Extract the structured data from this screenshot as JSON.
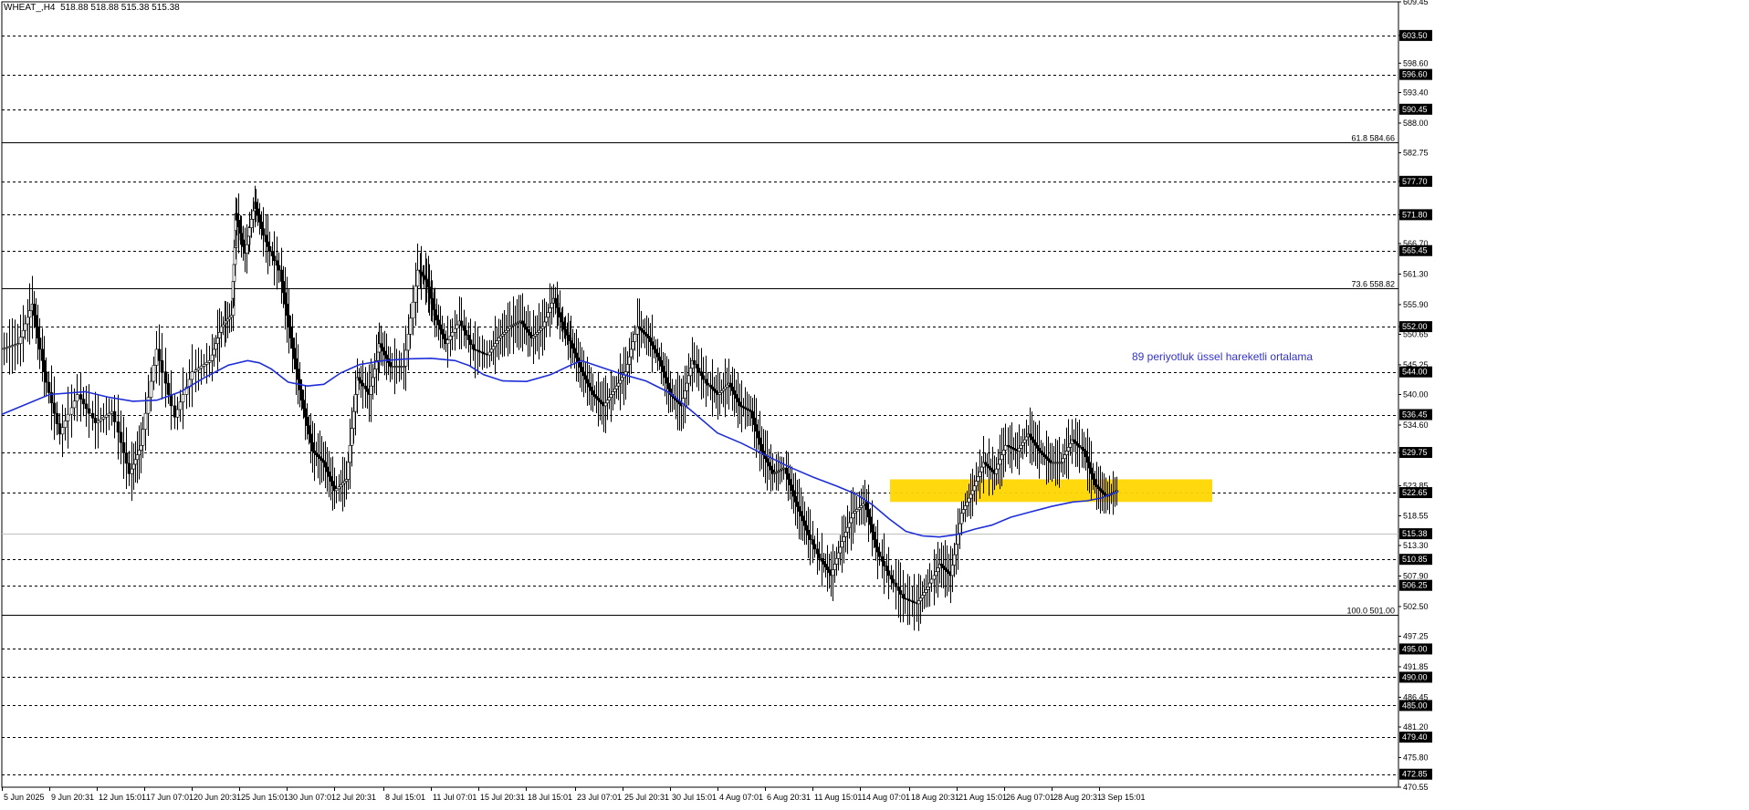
{
  "header": {
    "symbol": "WHEAT_,H4",
    "ohlc": "518.88 518.88 515.38 515.38"
  },
  "chart_data": {
    "type": "line",
    "title": "",
    "xlabel": "",
    "ylabel": "",
    "grid": false,
    "ylim": [
      470.55,
      609.45
    ],
    "y_ticks": [
      "609.45",
      "603.50",
      "598.60",
      "593.40",
      "588.00",
      "582.75",
      "577.70",
      "571.80",
      "566.70",
      "561.30",
      "555.90",
      "552.00",
      "550.65",
      "545.25",
      "540.00",
      "534.60",
      "529.75",
      "523.85",
      "518.55",
      "513.30",
      "507.90",
      "502.50",
      "497.25",
      "491.85",
      "486.45",
      "481.20",
      "475.80",
      "470.55"
    ],
    "x_ticks": [
      "5 Jun 2025",
      "9 Jun 20:31",
      "12 Jun 15:01",
      "17 Jun 07:01",
      "20 Jun 20:31",
      "25 Jun 15:01",
      "30 Jun 07:01",
      "2 Jul 20:31",
      "8 Jul 15:01",
      "11 Jul 07:01",
      "15 Jul 20:31",
      "18 Jul 15:01",
      "23 Jul 07:01",
      "25 Jul 20:31",
      "30 Jul 15:01",
      "4 Aug 07:01",
      "6 Aug 20:31",
      "11 Aug 15:01",
      "14 Aug 07:01",
      "18 Aug 20:31",
      "21 Aug 15:01",
      "26 Aug 07:01",
      "28 Aug 20:31",
      "3 Sep 15:01"
    ],
    "levels": [
      {
        "value": 603.5,
        "label": "603.50"
      },
      {
        "value": 596.6,
        "label": "596.60"
      },
      {
        "value": 590.45,
        "label": "590.45"
      },
      {
        "value": 577.7,
        "label": "577.70"
      },
      {
        "value": 571.8,
        "label": "571.80"
      },
      {
        "value": 565.45,
        "label": "565.45"
      },
      {
        "value": 552.0,
        "label": "552.00"
      },
      {
        "value": 544.0,
        "label": "544.00"
      },
      {
        "value": 536.45,
        "label": "536.45"
      },
      {
        "value": 529.75,
        "label": "529.75"
      },
      {
        "value": 522.65,
        "label": "522.65"
      },
      {
        "value": 510.85,
        "label": "510.85"
      },
      {
        "value": 506.25,
        "label": "506.25"
      },
      {
        "value": 495.0,
        "label": "495.00"
      },
      {
        "value": 490.0,
        "label": "490.00"
      },
      {
        "value": 485.0,
        "label": "485.00"
      },
      {
        "value": 479.4,
        "label": "479.40"
      },
      {
        "value": 472.85,
        "label": "472.85"
      }
    ],
    "fib_levels": [
      {
        "value": 584.66,
        "label": "61.8 584.66"
      },
      {
        "value": 558.82,
        "label": "73.6 558.82"
      },
      {
        "value": 501.0,
        "label": "100.0 501.00"
      }
    ],
    "current_price": {
      "value": 515.38,
      "label": "515.38"
    },
    "zone": {
      "low": 521.0,
      "high": 525.0,
      "color": "#ffd700"
    },
    "annotation": {
      "text": "89 periyotluk üssel hareketli ortalama",
      "color": "#3333cc"
    },
    "ema_color": "#1f2fd8",
    "path": [
      [
        0,
        548
      ],
      [
        12,
        549
      ],
      [
        22,
        556
      ],
      [
        30,
        544
      ],
      [
        42,
        533
      ],
      [
        55,
        540
      ],
      [
        68,
        535
      ],
      [
        80,
        537
      ],
      [
        92,
        526
      ],
      [
        100,
        531
      ],
      [
        112,
        548
      ],
      [
        125,
        536
      ],
      [
        138,
        544
      ],
      [
        150,
        546
      ],
      [
        158,
        552
      ],
      [
        165,
        554
      ],
      [
        168,
        572
      ],
      [
        175,
        565
      ],
      [
        182,
        574
      ],
      [
        190,
        567
      ],
      [
        200,
        562
      ],
      [
        208,
        550
      ],
      [
        216,
        539
      ],
      [
        224,
        530
      ],
      [
        232,
        528
      ],
      [
        240,
        523
      ],
      [
        248,
        525
      ],
      [
        256,
        543
      ],
      [
        265,
        540
      ],
      [
        272,
        549
      ],
      [
        280,
        545
      ],
      [
        290,
        545
      ],
      [
        300,
        562
      ],
      [
        306,
        560
      ],
      [
        312,
        554
      ],
      [
        320,
        549
      ],
      [
        330,
        553
      ],
      [
        340,
        548
      ],
      [
        350,
        547
      ],
      [
        358,
        550
      ],
      [
        366,
        552
      ],
      [
        374,
        553
      ],
      [
        382,
        550
      ],
      [
        390,
        552
      ],
      [
        398,
        557
      ],
      [
        404,
        552
      ],
      [
        410,
        549
      ],
      [
        418,
        544
      ],
      [
        426,
        540
      ],
      [
        434,
        538
      ],
      [
        442,
        541
      ],
      [
        450,
        544
      ],
      [
        458,
        552
      ],
      [
        466,
        550
      ],
      [
        474,
        546
      ],
      [
        482,
        540
      ],
      [
        490,
        538
      ],
      [
        498,
        546
      ],
      [
        508,
        542
      ],
      [
        516,
        540
      ],
      [
        524,
        542
      ],
      [
        532,
        538
      ],
      [
        540,
        537
      ],
      [
        548,
        530
      ],
      [
        556,
        526
      ],
      [
        564,
        527
      ],
      [
        572,
        521
      ],
      [
        580,
        516
      ],
      [
        590,
        511
      ],
      [
        598,
        508
      ],
      [
        606,
        514
      ],
      [
        614,
        519
      ],
      [
        622,
        521
      ],
      [
        630,
        513
      ],
      [
        640,
        508
      ],
      [
        650,
        504
      ],
      [
        660,
        503
      ],
      [
        668,
        506
      ],
      [
        676,
        510
      ],
      [
        684,
        508
      ],
      [
        692,
        519
      ],
      [
        700,
        523
      ],
      [
        708,
        528
      ],
      [
        716,
        526
      ],
      [
        724,
        531
      ],
      [
        732,
        530
      ],
      [
        740,
        533
      ],
      [
        748,
        530
      ],
      [
        756,
        528
      ],
      [
        764,
        528
      ],
      [
        772,
        532
      ],
      [
        780,
        530
      ],
      [
        788,
        524
      ],
      [
        796,
        522
      ],
      [
        804,
        523
      ]
    ],
    "ema": [
      [
        0,
        536.5
      ],
      [
        40,
        540
      ],
      [
        70,
        540.5
      ],
      [
        90,
        539.5
      ],
      [
        110,
        538.8
      ],
      [
        130,
        539
      ],
      [
        150,
        540.5
      ],
      [
        170,
        543
      ],
      [
        190,
        545.2
      ],
      [
        206,
        546
      ],
      [
        216,
        545.6
      ],
      [
        226,
        544.5
      ],
      [
        240,
        542.2
      ],
      [
        256,
        541.5
      ],
      [
        270,
        541.8
      ],
      [
        284,
        543.8
      ],
      [
        300,
        545.3
      ],
      [
        320,
        546
      ],
      [
        340,
        546.3
      ],
      [
        360,
        546.4
      ],
      [
        380,
        546
      ],
      [
        392,
        545.1
      ],
      [
        404,
        543.5
      ],
      [
        420,
        542.4
      ],
      [
        440,
        542.3
      ],
      [
        460,
        543.5
      ],
      [
        476,
        545.1
      ],
      [
        486,
        546
      ],
      [
        500,
        545
      ],
      [
        520,
        543.6
      ],
      [
        540,
        542.4
      ],
      [
        560,
        540.3
      ],
      [
        580,
        536.8
      ],
      [
        600,
        533.2
      ],
      [
        620,
        531.4
      ],
      [
        640,
        529.3
      ],
      [
        660,
        527.2
      ],
      [
        680,
        525.4
      ],
      [
        700,
        523.8
      ],
      [
        716,
        522.4
      ],
      [
        730,
        520.5
      ],
      [
        744,
        518
      ],
      [
        758,
        515.8
      ],
      [
        772,
        515
      ],
      [
        786,
        514.8
      ],
      [
        800,
        515.2
      ],
      [
        816,
        516.2
      ],
      [
        830,
        516.9
      ],
      [
        846,
        518.3
      ],
      [
        862,
        519.2
      ],
      [
        880,
        520.2
      ],
      [
        898,
        521
      ],
      [
        910,
        521.2
      ],
      [
        922,
        521.7
      ],
      [
        930,
        522.4
      ],
      [
        936,
        522.8
      ]
    ],
    "ema_ticks": [
      1916,
      888
    ]
  }
}
